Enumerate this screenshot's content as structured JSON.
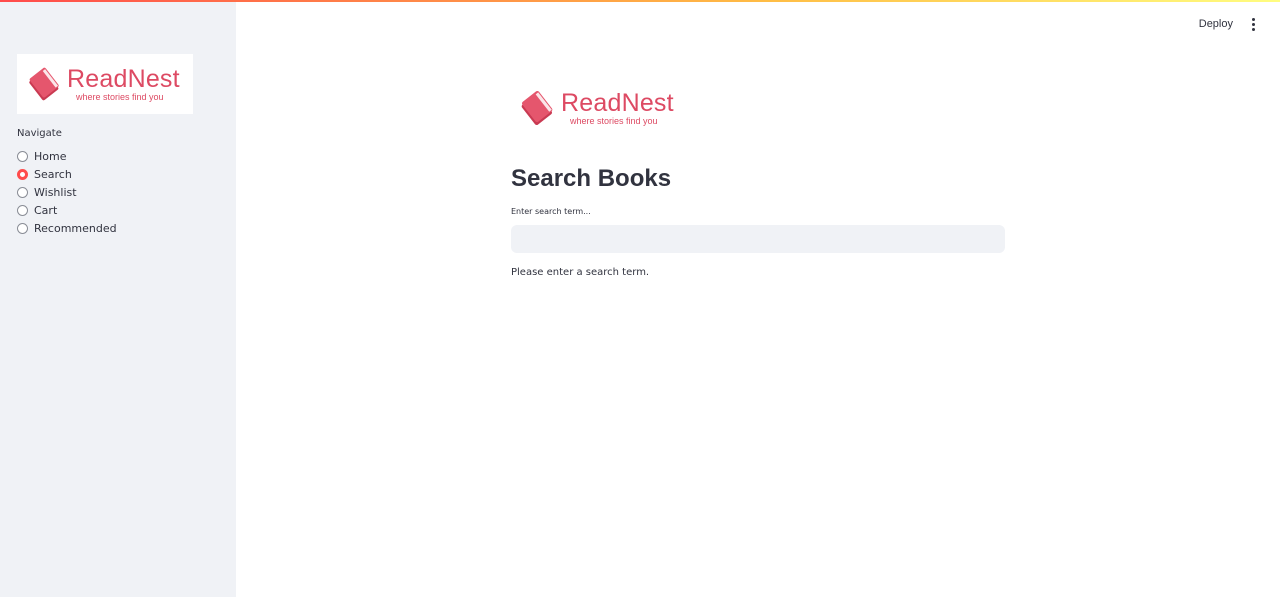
{
  "colors": {
    "accent": "#ff4b4b",
    "brand": "#dd4a63",
    "sidebar_bg": "#f0f2f6",
    "text": "#31333f"
  },
  "header": {
    "deploy_label": "Deploy",
    "menu_icon": "kebab-menu-icon"
  },
  "logo": {
    "brand": "ReadNest",
    "tagline": "where stories find you",
    "icon": "book-icon"
  },
  "sidebar": {
    "nav_label": "Navigate",
    "items": [
      {
        "label": "Home",
        "selected": false
      },
      {
        "label": "Search",
        "selected": true
      },
      {
        "label": "Wishlist",
        "selected": false
      },
      {
        "label": "Cart",
        "selected": false
      },
      {
        "label": "Recommended",
        "selected": false
      }
    ]
  },
  "main": {
    "title": "Search Books",
    "search": {
      "label": "Enter search term...",
      "value": ""
    },
    "info": "Please enter a search term."
  }
}
